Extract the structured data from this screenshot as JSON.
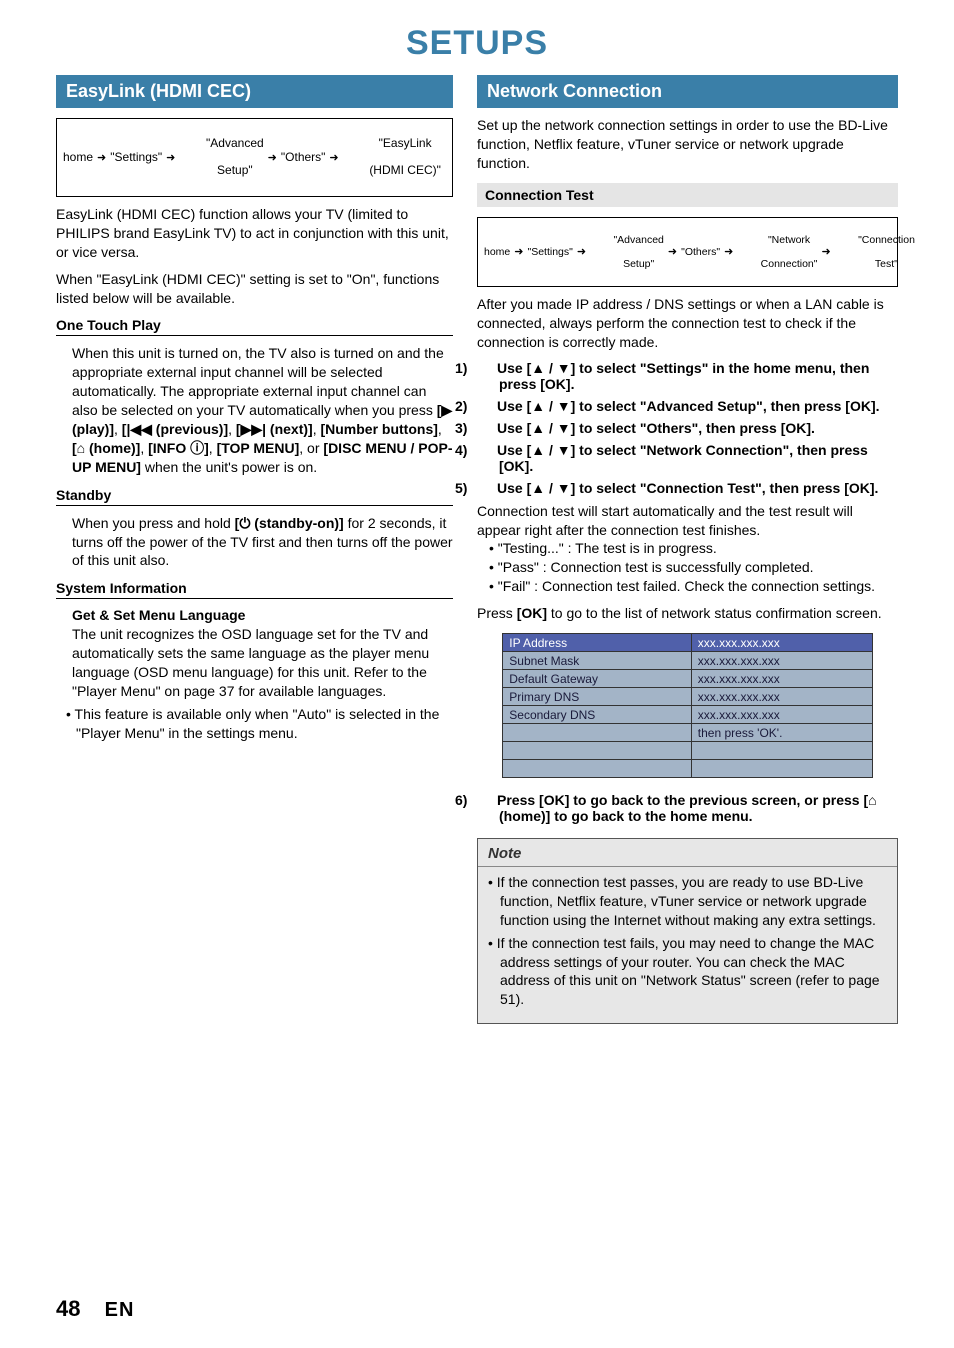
{
  "page": {
    "title": "SETUPS",
    "number": "48",
    "lang": "EN"
  },
  "left": {
    "heading": "EasyLink (HDMI CEC)",
    "crumbs": {
      "c1": "home",
      "c2": "\"Settings\"",
      "c3_l1": "\"Advanced",
      "c3_l2": "Setup\"",
      "c4": "\"Others\"",
      "c5_l1": "\"EasyLink",
      "c5_l2": "(HDMI CEC)\""
    },
    "intro": "EasyLink (HDMI CEC) function allows your TV (limited to PHILIPS brand EasyLink TV) to act in conjunction with this unit, or vice versa.",
    "when_on": "When \"EasyLink (HDMI CEC)\" setting is set to \"On\", functions listed below will be available.",
    "otp_head": "One Touch Play",
    "otp_body_1": "When this unit is turned on, the TV also is turned on and the appropriate external input channel will be selected automatically. The appropriate external input channel can also be selected on your TV automatically when you press ",
    "otp_keys_1": "[▶ (play)]",
    "otp_comma1": ", ",
    "otp_keys_2": "[|◀◀ (previous)]",
    "otp_comma2": ", ",
    "otp_keys_3": "[▶▶| (next)]",
    "otp_comma3": ", ",
    "otp_keys_4": "[Number buttons]",
    "otp_comma4": ", ",
    "otp_keys_5": "[⌂ (home)]",
    "otp_comma5": ", ",
    "otp_keys_6": "[INFO ⓘ]",
    "otp_comma6": ", ",
    "otp_keys_7": "[TOP MENU]",
    "otp_or": ", or ",
    "otp_keys_8": "[DISC MENU / POP-UP MENU]",
    "otp_tail": " when the unit's power is on.",
    "standby_head": "Standby",
    "standby_body_1": "When you press and hold ",
    "standby_key": "[⏻ (standby-on)]",
    "standby_body_2": " for 2 seconds, it turns off the power of the TV first and then turns off the power of this unit also.",
    "sysinfo_head": "System Information",
    "getset_head": "Get & Set Menu Language",
    "getset_body": "The unit recognizes the OSD language set for the TV and automatically sets the same language as the player menu language (OSD menu language) for this unit. Refer to the \"Player Menu\" on page 37 for available languages.",
    "footnote": "This feature is available only when \"Auto\" is selected in the \"Player Menu\" in the settings menu."
  },
  "right": {
    "heading": "Network Connection",
    "intro": "Set up the network connection settings in order to use the BD-Live function, Netflix feature, vTuner service or network upgrade function.",
    "conntest_bar": "Connection Test",
    "crumbs": {
      "c1": "home",
      "c2": "\"Settings\"",
      "c3_l1": "\"Advanced",
      "c3_l2": "Setup\"",
      "c4": "\"Others\"",
      "c5_l1": "\"Network",
      "c5_l2": "Connection\"",
      "c6_l1": "\"Connection",
      "c6_l2": "Test\""
    },
    "after": "After you made IP address / DNS settings or when a LAN cable is connected, always perform the connection test to check if the connection is correctly made.",
    "steps": {
      "s1": "Use [▲ / ▼] to select \"Settings\" in the home menu, then press [OK].",
      "s2": "Use [▲ / ▼] to select \"Advanced Setup\", then press [OK].",
      "s3": "Use [▲ / ▼] to select \"Others\", then press [OK].",
      "s4": "Use [▲ / ▼] to select \"Network Connection\", then press [OK].",
      "s5": "Use [▲ / ▼] to select \"Connection Test\", then press [OK]."
    },
    "connresult": "Connection test will start automatically and the test result will appear right after the connection test finishes.",
    "statuses": {
      "a": "\"Testing...\" : The test is in progress.",
      "b": "\"Pass\" : Connection test is successfully completed.",
      "c": "\"Fail\" : Connection test failed. Check the connection settings."
    },
    "pressok": "Press [OK] to go to the list of network status confirmation screen.",
    "table": {
      "r1k": "IP Address",
      "r1v": "xxx.xxx.xxx.xxx",
      "r2k": "Subnet Mask",
      "r2v": "xxx.xxx.xxx.xxx",
      "r3k": "Default Gateway",
      "r3v": "xxx.xxx.xxx.xxx",
      "r4k": "Primary DNS",
      "r4v": "xxx.xxx.xxx.xxx",
      "r5k": "Secondary DNS",
      "r5v": "xxx.xxx.xxx.xxx",
      "r6v": "then press 'OK'."
    },
    "step6": "Press [OK] to go back to the previous screen, or press [⌂ (home)] to go back to the home menu.",
    "note_title": "Note",
    "notes": {
      "n1": "If the connection test passes, you are ready to use BD-Live function, Netflix feature, vTuner service or network upgrade function using the Internet without making any extra settings.",
      "n2": "If the connection test fails, you may need to change the MAC address settings of your router. You can check the MAC address of this unit on \"Network Status\" screen (refer to page 51)."
    }
  }
}
